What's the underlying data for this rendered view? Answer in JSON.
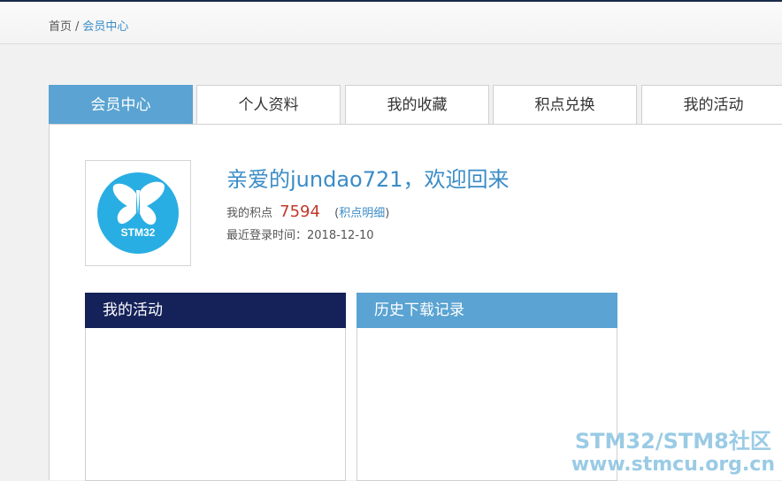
{
  "breadcrumb": {
    "home": "首页",
    "separator": "/",
    "current": "会员中心"
  },
  "tabs": [
    {
      "label": "会员中心",
      "active": true
    },
    {
      "label": "个人资料",
      "active": false
    },
    {
      "label": "我的收藏",
      "active": false
    },
    {
      "label": "积点兑换",
      "active": false
    },
    {
      "label": "我的活动",
      "active": false
    }
  ],
  "profile": {
    "avatar_text": "STM32",
    "welcome": "亲爱的jundao721，欢迎回来",
    "points_label": "我的积点",
    "points_value": "7594",
    "points_detail_open": "(",
    "points_detail_link": "积点明细",
    "points_detail_close": ")",
    "last_login_label": "最近登录时间：",
    "last_login_value": "2018-12-10"
  },
  "boxes": {
    "activity_title": "我的活动",
    "history_title": "历史下载记录"
  },
  "watermark": {
    "line1": "STM32/STM8社区",
    "line2": "www.stmcu.org.cn"
  },
  "colors": {
    "accent": "#5aa3d2",
    "navy": "#152259",
    "points": "#c0392b",
    "link": "#3a8cc7"
  }
}
